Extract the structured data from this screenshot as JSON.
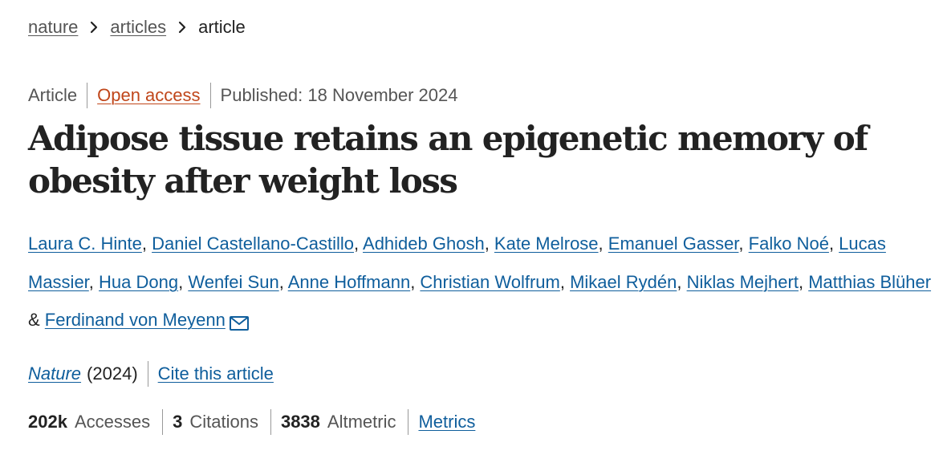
{
  "breadcrumb": {
    "items": [
      {
        "label": "nature"
      },
      {
        "label": "articles"
      },
      {
        "label": "article"
      }
    ]
  },
  "meta": {
    "type": "Article",
    "access": "Open access",
    "published": "Published: 18 November 2024"
  },
  "title": "Adipose tissue retains an epigenetic memory of obesity after weight loss",
  "authors": [
    "Laura C. Hinte",
    "Daniel Castellano-Castillo",
    "Adhideb Ghosh",
    "Kate Melrose",
    "Emanuel Gasser",
    "Falko Noé",
    "Lucas Massier",
    "Hua Dong",
    "Wenfei Sun",
    "Anne Hoffmann",
    "Christian Wolfrum",
    "Mikael Rydén",
    "Niklas Mejhert",
    "Matthias Blüher",
    "Ferdinand von Meyenn"
  ],
  "author_separator": ", ",
  "author_last_separator": " & ",
  "journal": {
    "name": "Nature",
    "year": "(2024)",
    "cite": "Cite this article"
  },
  "metrics": {
    "accesses_value": "202k",
    "accesses_label": "Accesses",
    "citations_value": "3",
    "citations_label": "Citations",
    "altmetric_value": "3838",
    "altmetric_label": "Altmetric",
    "metrics_link": "Metrics"
  },
  "icons": {
    "breadcrumb_separator": "chevron-right-icon",
    "corresponding_author": "mail-icon"
  },
  "colors": {
    "link": "#0f5e9c",
    "open_access": "#c0461a",
    "text": "#222222",
    "muted": "#555555"
  }
}
